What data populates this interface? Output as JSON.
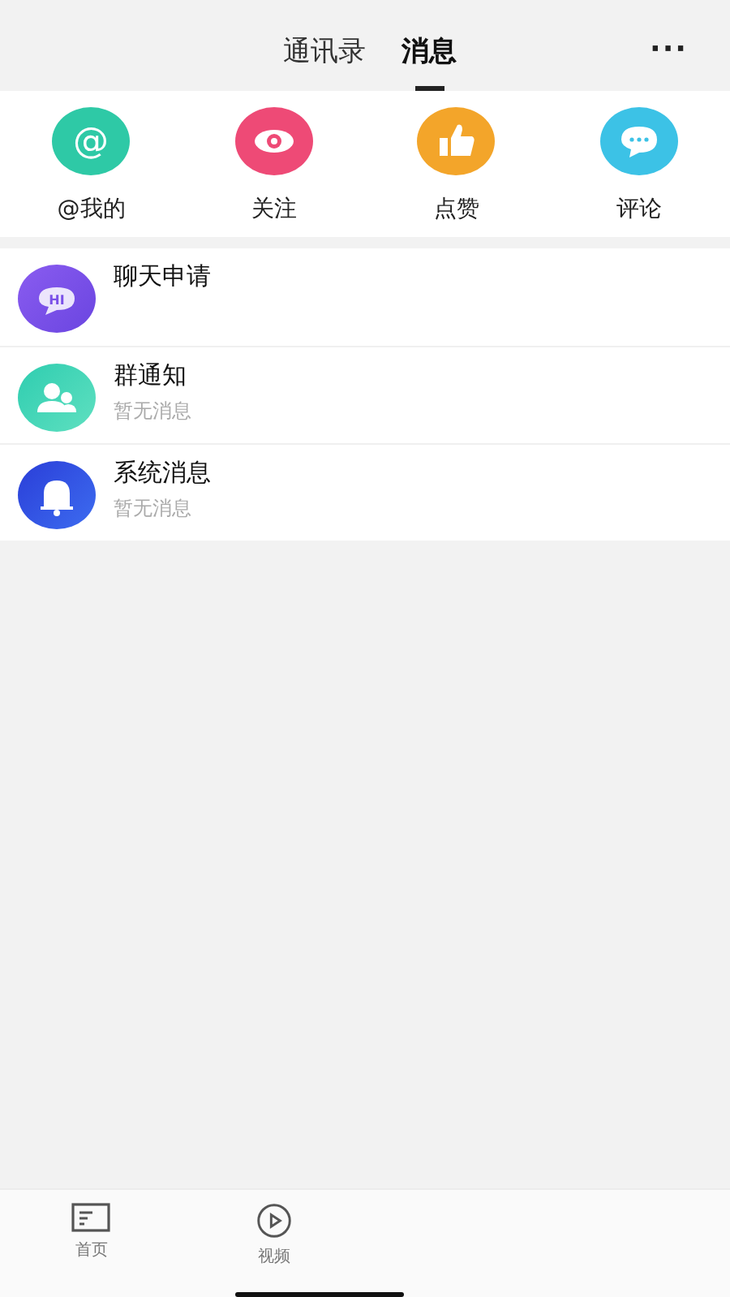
{
  "header": {
    "tabs": [
      {
        "label": "通讯录",
        "selected": false
      },
      {
        "label": "消息",
        "selected": true
      }
    ],
    "more": "···"
  },
  "shortcuts": [
    {
      "kind": "mention",
      "label": "@我的",
      "color": "#2ec9a6",
      "icon_text": "@"
    },
    {
      "kind": "follow",
      "label": "关注",
      "color": "#ee4a76"
    },
    {
      "kind": "like",
      "label": "点赞",
      "color": "#f3a52a"
    },
    {
      "kind": "comment",
      "label": "评论",
      "color": "#3cc2e6"
    }
  ],
  "messages": [
    {
      "kind": "chat",
      "title": "聊天申请",
      "icon_text": "HI"
    },
    {
      "kind": "group",
      "title": "群通知",
      "subtitle": "暂无消息"
    },
    {
      "kind": "system",
      "title": "系统消息",
      "subtitle": "暂无消息"
    }
  ],
  "tab_bar": [
    {
      "kind": "home",
      "label": "首页",
      "selected": false
    },
    {
      "kind": "video",
      "label": "视频",
      "selected": false
    }
  ]
}
